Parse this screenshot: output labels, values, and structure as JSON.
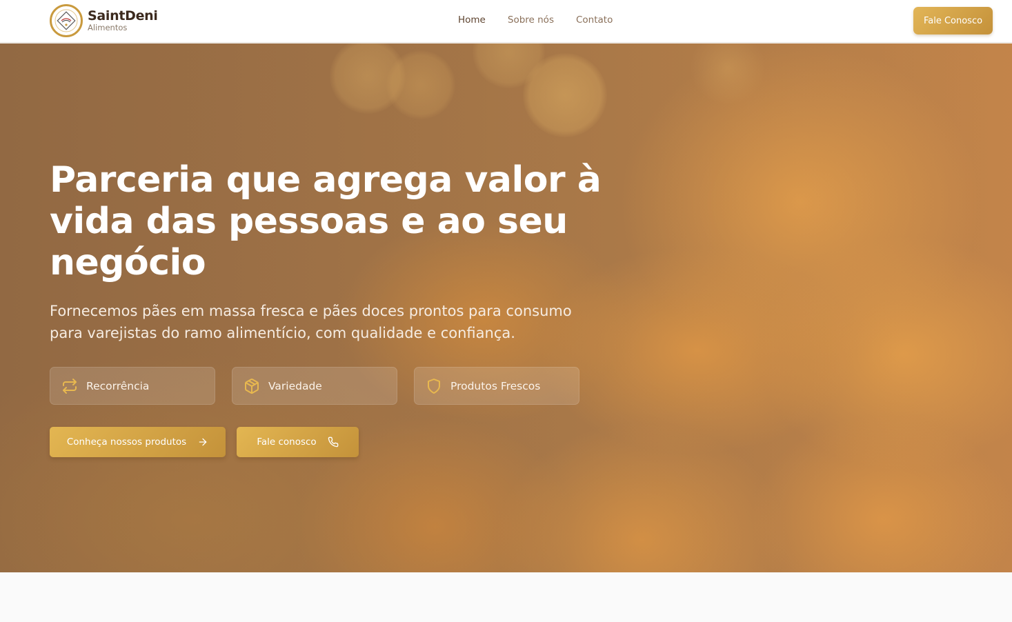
{
  "header": {
    "brand_name": "SaintDeni",
    "brand_sub": "Alimentos",
    "nav": [
      {
        "label": "Home",
        "active": true
      },
      {
        "label": "Sobre nós",
        "active": false
      },
      {
        "label": "Contato",
        "active": false
      }
    ],
    "cta_label": "Fale Conosco"
  },
  "hero": {
    "title": "Parceria que agrega valor à vida das pessoas e ao seu negócio",
    "subtitle": "Fornecemos pães em massa fresca e pães doces prontos para consumo para varejistas do ramo alimentício, com qualidade e confiança.",
    "features": [
      {
        "label": "Recorrência",
        "icon": "repeat-icon"
      },
      {
        "label": "Variedade",
        "icon": "package-icon"
      },
      {
        "label": "Produtos Frescos",
        "icon": "shield-icon"
      }
    ],
    "primary_button": {
      "label": "Conheça nossos produtos",
      "icon": "arrow-right-icon"
    },
    "secondary_button": {
      "label": "Fale conosco",
      "icon": "phone-icon"
    }
  },
  "colors": {
    "accent": "#d4a34a",
    "accent_dark": "#c4913a",
    "brand_text": "#3c2a1e",
    "nav_text": "#8a705a"
  }
}
